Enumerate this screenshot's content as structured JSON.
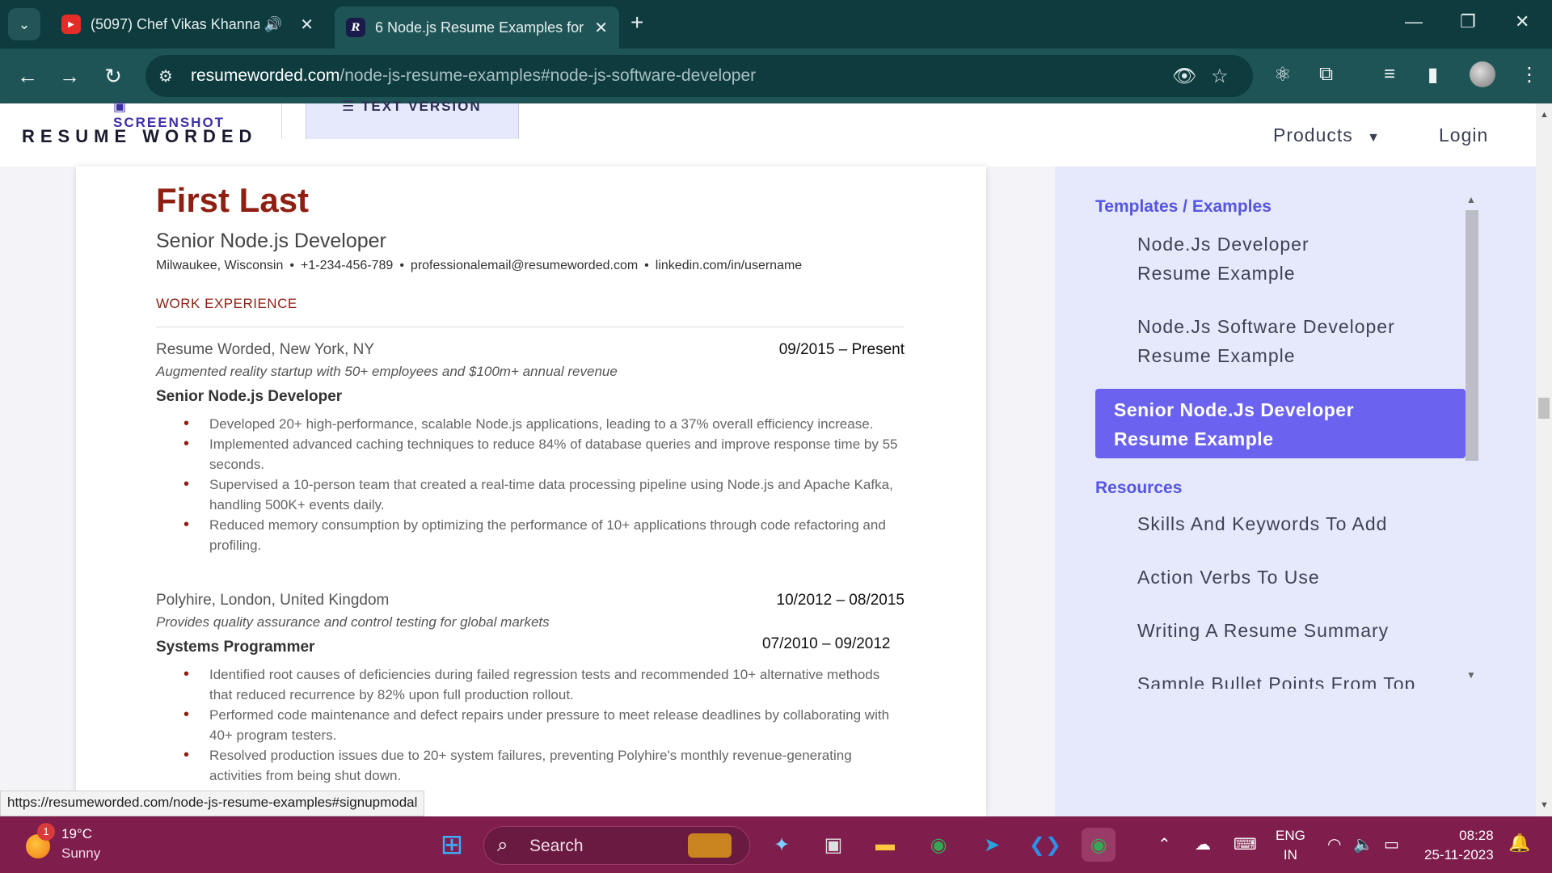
{
  "browser": {
    "tabs": [
      {
        "title": "(5097) Chef Vikas Khanna -",
        "favicon": "youtube-icon",
        "active": false
      },
      {
        "title": "6 Node.js Resume Examples for",
        "favicon": "resume-worded-icon",
        "active": true
      }
    ],
    "url": {
      "host": "resumeworded.com",
      "path": "/node-js-resume-examples#node-js-software-developer"
    },
    "status_url": "https://resumeworded.com/node-js-resume-examples#signupmodal"
  },
  "header": {
    "logo": "RESUME WORDED",
    "view_tabs": {
      "screenshot": "SCREENSHOT",
      "text_version": "TEXT VERSION"
    },
    "products": "Products",
    "login": "Login"
  },
  "resume": {
    "name": "First Last",
    "title": "Senior Node.js Developer",
    "contact": [
      "Milwaukee, Wisconsin",
      "+1-234-456-789",
      "professionalemail@resumeworded.com",
      "linkedin.com/in/username"
    ],
    "section": "WORK EXPERIENCE",
    "jobs": [
      {
        "company": "Resume Worded, New York, NY",
        "dates": "09/2015 – Present",
        "description": "Augmented reality startup with 50+ employees and $100m+ annual revenue",
        "role": "Senior Node.js Developer",
        "bullets": [
          "Developed 20+ high-performance, scalable Node.js applications, leading to a 37% overall efficiency increase.",
          "Implemented advanced caching techniques to reduce 84% of database queries and improve response time by 55 seconds.",
          "Supervised a 10-person team that created a real-time data processing pipeline using Node.js and Apache Kafka, handling 500K+ events daily.",
          "Reduced memory consumption by optimizing the performance of 10+ applications through code refactoring and profiling."
        ]
      },
      {
        "company": "Polyhire, London, United Kingdom",
        "dates": "10/2012 – 08/2015",
        "description": "Provides quality assurance and control testing for global markets",
        "role": "Systems Programmer",
        "bullets": [
          "Identified root causes of deficiencies during failed regression tests and recommended 10+ alternative methods that reduced recurrence by 82% upon full production rollout.",
          "Performed code maintenance and defect repairs under pressure to meet release deadlines by collaborating with 40+ program testers.",
          "Resolved production issues due to 20+ system failures, preventing Polyhire's monthly revenue-generating activities from being shut down."
        ]
      }
    ],
    "next_job_dates": "07/2010 – 09/2012"
  },
  "sidebar": {
    "templates_heading": "Templates / Examples",
    "templates": [
      {
        "line1": "Node.Js Developer",
        "line2": "Resume Example"
      },
      {
        "line1": "Node.Js Software Developer",
        "line2": "Resume Example"
      }
    ],
    "active": {
      "line1": "Senior Node.Js Developer",
      "line2": "Resume Example"
    },
    "resources_heading": "Resources",
    "resources": [
      "Skills And Keywords To Add",
      "Action Verbs To Use",
      "Writing A Resume Summary",
      "Sample Bullet Points From Top"
    ]
  },
  "taskbar": {
    "weather_badge": "1",
    "temperature": "19°C",
    "condition": "Sunny",
    "search_label": "Search",
    "lang_line1": "ENG",
    "lang_line2": "IN",
    "time": "08:28",
    "date": "25-11-2023"
  },
  "colors": {
    "chrome_dark": "#0d3b3e",
    "chrome_toolbar": "#1f5457",
    "resume_accent": "#8e1f11",
    "sidebar_bg": "#e6e9fb",
    "sidebar_active": "#6b63f0",
    "taskbar": "#7f1d4c"
  }
}
